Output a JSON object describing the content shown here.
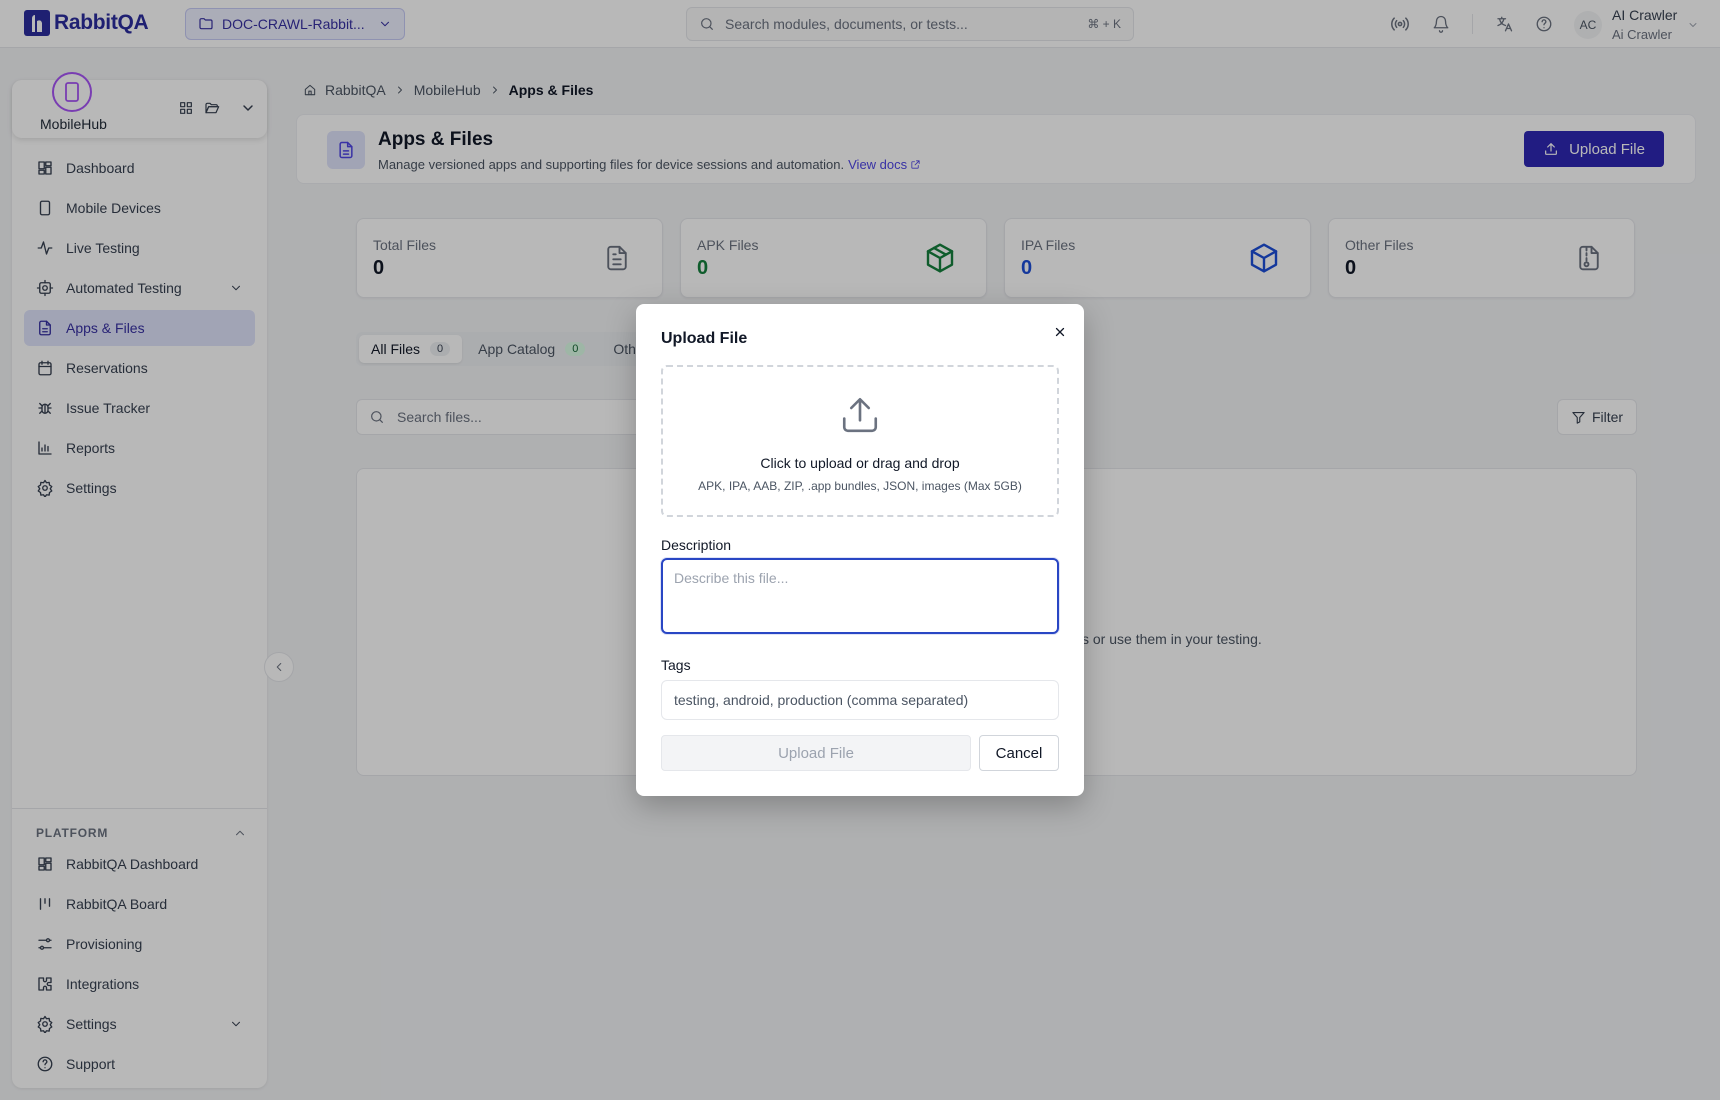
{
  "topbar": {
    "brand": "RabbitQA",
    "project": "DOC-CRAWL-Rabbit...",
    "search_placeholder": "Search modules, documents, or tests...",
    "search_shortcut": "⌘ + K",
    "user_initials": "AC",
    "user_name": "AI Crawler",
    "user_sub": "Ai Crawler"
  },
  "hub": {
    "name": "MobileHub"
  },
  "sidebar": {
    "items": [
      {
        "label": "Dashboard",
        "icon": "layout-grid-icon"
      },
      {
        "label": "Mobile Devices",
        "icon": "smartphone-icon"
      },
      {
        "label": "Live Testing",
        "icon": "activity-icon"
      },
      {
        "label": "Automated Testing",
        "icon": "bot-icon"
      },
      {
        "label": "Apps & Files",
        "icon": "file-text-icon",
        "active": true
      },
      {
        "label": "Reservations",
        "icon": "calendar-icon"
      },
      {
        "label": "Issue Tracker",
        "icon": "bug-icon"
      },
      {
        "label": "Reports",
        "icon": "bar-chart-icon"
      },
      {
        "label": "Settings",
        "icon": "settings-icon"
      }
    ],
    "platform_heading": "PLATFORM",
    "platform_items": [
      {
        "label": "RabbitQA Dashboard",
        "icon": "layout-grid-icon"
      },
      {
        "label": "RabbitQA Board",
        "icon": "kanban-icon"
      },
      {
        "label": "Provisioning",
        "icon": "sliders-icon"
      },
      {
        "label": "Integrations",
        "icon": "puzzle-icon"
      },
      {
        "label": "Settings",
        "icon": "settings-icon"
      },
      {
        "label": "Support",
        "icon": "help-circle-icon"
      }
    ]
  },
  "breadcrumb": {
    "home": "RabbitQA",
    "parent": "MobileHub",
    "current": "Apps & Files"
  },
  "page": {
    "title": "Apps & Files",
    "subtitle": "Manage versioned apps and supporting files for device sessions and automation.",
    "docs_link": "View docs",
    "upload_button": "Upload File"
  },
  "stats": [
    {
      "label": "Total Files",
      "value": "0",
      "color": "#111827"
    },
    {
      "label": "APK Files",
      "value": "0",
      "color": "#15803d"
    },
    {
      "label": "IPA Files",
      "value": "0",
      "color": "#1d4ed8"
    },
    {
      "label": "Other Files",
      "value": "0",
      "color": "#111827"
    }
  ],
  "tabs": [
    {
      "label": "All Files",
      "count": "0"
    },
    {
      "label": "App Catalog",
      "count": "0"
    },
    {
      "label": "Oth",
      "count": ""
    }
  ],
  "files": {
    "search_placeholder": "Search files...",
    "filter_label": "Filter",
    "empty_fragment": "s or use them in your testing."
  },
  "modal": {
    "title": "Upload File",
    "drop_main": "Click to upload or drag and drop",
    "drop_sub": "APK, IPA, AAB, ZIP, .app bundles, JSON, images (Max 5GB)",
    "description_label": "Description",
    "description_placeholder": "Describe this file...",
    "tags_label": "Tags",
    "tags_placeholder": "testing, android, production (comma separated)",
    "upload_label": "Upload File",
    "cancel_label": "Cancel"
  }
}
